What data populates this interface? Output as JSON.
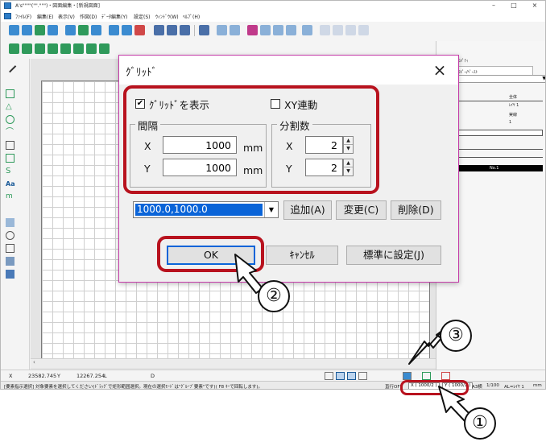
{
  "app": {
    "title": "A's\"\"\"\"(\"\".\"\"\")・図面編集・[新規図面]",
    "window_buttons": {
      "minimize": "–",
      "maximize": "□",
      "close": "×"
    },
    "menu": [
      "ﾌｧｲﾙ(F)",
      "編集(E)",
      "表示(V)",
      "作図(D)",
      "ﾃﾞｰﾀ編集(Y)",
      "設定(S)",
      "ｳｨﾝﾄﾞｳ(W)",
      "ﾍﾙﾌﾟ(H)"
    ],
    "panel": {
      "title": "ﾌﾟﾛﾊﾟﾃｨ",
      "tab": "ｺﾋﾟｰ/ﾍﾟｰｽﾄ",
      "rows": [
        "全体",
        "ﾚｲﾔ 1",
        "実線",
        "1",
        "No.1"
      ]
    },
    "coords": {
      "x_label": "X",
      "x_value": "23582.745",
      "y_label": "Y",
      "y_value": "12267.254",
      "l_label": "L",
      "d_label": "D"
    },
    "status": {
      "message": "[要素指示選択]  対象要素を選択してください(ﾄﾞﾗｯｸﾞで矩形範囲選択。現在の選択ﾓｰﾄﾞは\"ｸﾞﾙｰﾌﾟ要素\"です)( F8 ｷｰで回転します)。",
      "snap": "直行OFF",
      "grid_x": "X ( 1000/2 )",
      "grid_y": "Y ( 1000/2 )",
      "paper": "A3横",
      "scale": "1/100",
      "layer": "AL=ﾚｲﾔ 1",
      "unit": "mm"
    }
  },
  "dialog": {
    "title": "ｸﾞﾘｯﾄﾞ",
    "close_icon": "×",
    "show_grid": {
      "label": "ｸﾞﾘｯﾄﾞを表示",
      "checked": "✔"
    },
    "xy_link": {
      "label": "XY連動",
      "checked": ""
    },
    "interval": {
      "title": "間隔",
      "x_label": "X",
      "x_value": "1000",
      "x_unit": "mm",
      "y_label": "Y",
      "y_value": "1000",
      "y_unit": "mm"
    },
    "divisions": {
      "title": "分割数",
      "x_label": "X",
      "x_value": "2",
      "y_label": "Y",
      "y_value": "2"
    },
    "preset": {
      "value": "1000.0,1000.0",
      "arrow": "▼"
    },
    "add_label": "追加(A)",
    "change_label": "変更(C)",
    "delete_label": "削除(D)",
    "ok_label": "OK",
    "cancel_label": "ｷｬﾝｾﾙ",
    "default_label": "標準に設定(J)"
  },
  "callouts": {
    "one": "①",
    "two": "②",
    "three": "③"
  },
  "colors": {
    "highlight": "#b8121e",
    "dialog_border": "#c53aa8",
    "selection": "#0a64d8"
  }
}
